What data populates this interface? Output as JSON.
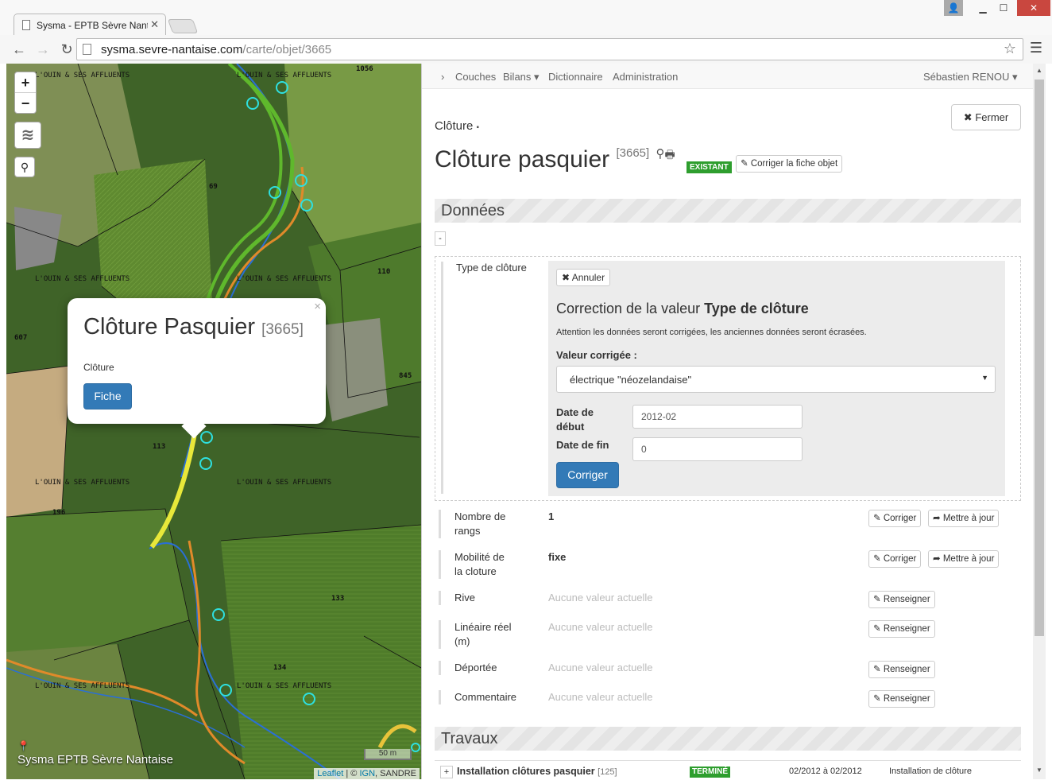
{
  "browser": {
    "tab_title": "Sysma - EPTB Sèvre Nanta",
    "url_host": "sysma.sevre-nantaise.com",
    "url_path": "/carte/objet/3665"
  },
  "map": {
    "popup": {
      "title": "Clôture Pasquier",
      "id": "[3665]",
      "type": "Clôture",
      "button": "Fiche"
    },
    "brand": "Sysma EPTB Sèvre Nantaise",
    "scale": "50 m",
    "attribution": {
      "leaflet": "Leaflet",
      "sep": " | © ",
      "ign": "IGN",
      "sandre": ", SANDRE"
    },
    "river_label": "L'OUIN & SES AFFLUENTS",
    "parcels": [
      "1056",
      "69",
      "110",
      "607",
      "113",
      "196",
      "133",
      "134",
      "845"
    ]
  },
  "nav": {
    "items": [
      "Couches",
      "Bilans",
      "Dictionnaire",
      "Administration"
    ],
    "user": "Sébastien RENOU"
  },
  "object": {
    "category": "Clôture",
    "close": "Fermer",
    "title": "Clôture pasquier",
    "id": "[3665]",
    "status": "EXISTANT",
    "edit_link": "Corriger la fiche objet"
  },
  "sections": {
    "donnees": "Données",
    "travaux": "Travaux"
  },
  "editor": {
    "field": "Type de clôture",
    "cancel": "Annuler",
    "heading_prefix": "Correction de la valeur",
    "heading_field": "Type de clôture",
    "warning": "Attention les données seront corrigées, les anciennes données seront écrasées.",
    "value_label": "Valeur corrigée :",
    "value": "électrique \"néozelandaise\"",
    "start_label": "Date de début",
    "start_value": "2012-02",
    "end_label": "Date de fin",
    "end_value": "0",
    "submit": "Corriger"
  },
  "fields": [
    {
      "label": "Nombre de rangs",
      "value": "1",
      "actions": [
        "Corriger",
        "Mettre à jour"
      ]
    },
    {
      "label": "Mobilité de la cloture",
      "value": "fixe",
      "actions": [
        "Corriger",
        "Mettre à jour"
      ]
    },
    {
      "label": "Rive",
      "value": "Aucune valeur actuelle",
      "actions": [
        "Renseigner"
      ]
    },
    {
      "label": "Linéaire réel (m)",
      "value": "Aucune valeur actuelle",
      "actions": [
        "Renseigner"
      ]
    },
    {
      "label": "Déportée",
      "value": "Aucune valeur actuelle",
      "actions": [
        "Renseigner"
      ]
    },
    {
      "label": "Commentaire",
      "value": "Aucune valeur actuelle",
      "actions": [
        "Renseigner"
      ]
    }
  ],
  "travaux": [
    {
      "name": "Installation clôtures pasquier",
      "id": "[125]",
      "status": "TERMINÉ",
      "dates": "02/2012 à 02/2012",
      "type": "Installation de clôture"
    }
  ],
  "colors": {
    "primary": "#337ab7",
    "success": "#2e9e2e",
    "river": "#2a6fd6",
    "track_green": "#5fb82c",
    "track_orange": "#e08a2a",
    "marker": "#2ee0e0"
  }
}
